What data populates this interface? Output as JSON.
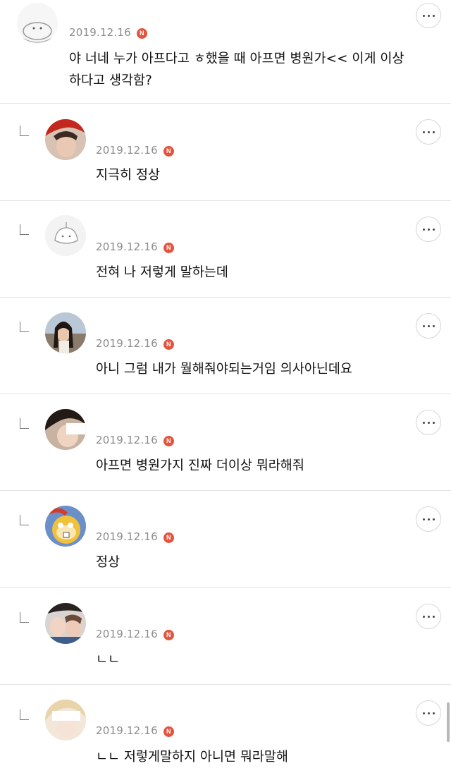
{
  "comments": [
    {
      "date": "2019.12.16",
      "badge": "N",
      "text": "야 너네 누가 아프다고 ㅎ했을 때 아프면 병원가<< 이게 이상\n하다고 생각함?",
      "is_reply": false
    },
    {
      "date": "2019.12.16",
      "badge": "N",
      "text": "지극히 정상",
      "is_reply": true
    },
    {
      "date": "2019.12.16",
      "badge": "N",
      "text": "전혀 나 저렇게 말하는데",
      "is_reply": true
    },
    {
      "date": "2019.12.16",
      "badge": "N",
      "text": "아니 그럼 내가 뭘해줘야되는거임 의사아닌데요",
      "is_reply": true
    },
    {
      "date": "2019.12.16",
      "badge": "N",
      "text": "아프면 병원가지 진짜 더이상 뭐라해줘",
      "is_reply": true
    },
    {
      "date": "2019.12.16",
      "badge": "N",
      "text": "정상",
      "is_reply": true
    },
    {
      "date": "2019.12.16",
      "badge": "N",
      "text": "ㄴㄴ",
      "is_reply": true
    },
    {
      "date": "2019.12.16",
      "badge": "N",
      "text": "ㄴㄴ 저렇게말하지 아니면 뭐라말해",
      "is_reply": true
    }
  ],
  "icons": {
    "more": "more-horizontal-icon",
    "reply": "reply-arrow-icon",
    "badge": "new-badge-icon"
  },
  "colors": {
    "badge": "#e2543d",
    "date": "#8c8c8c",
    "divider": "#e4e4e4"
  }
}
